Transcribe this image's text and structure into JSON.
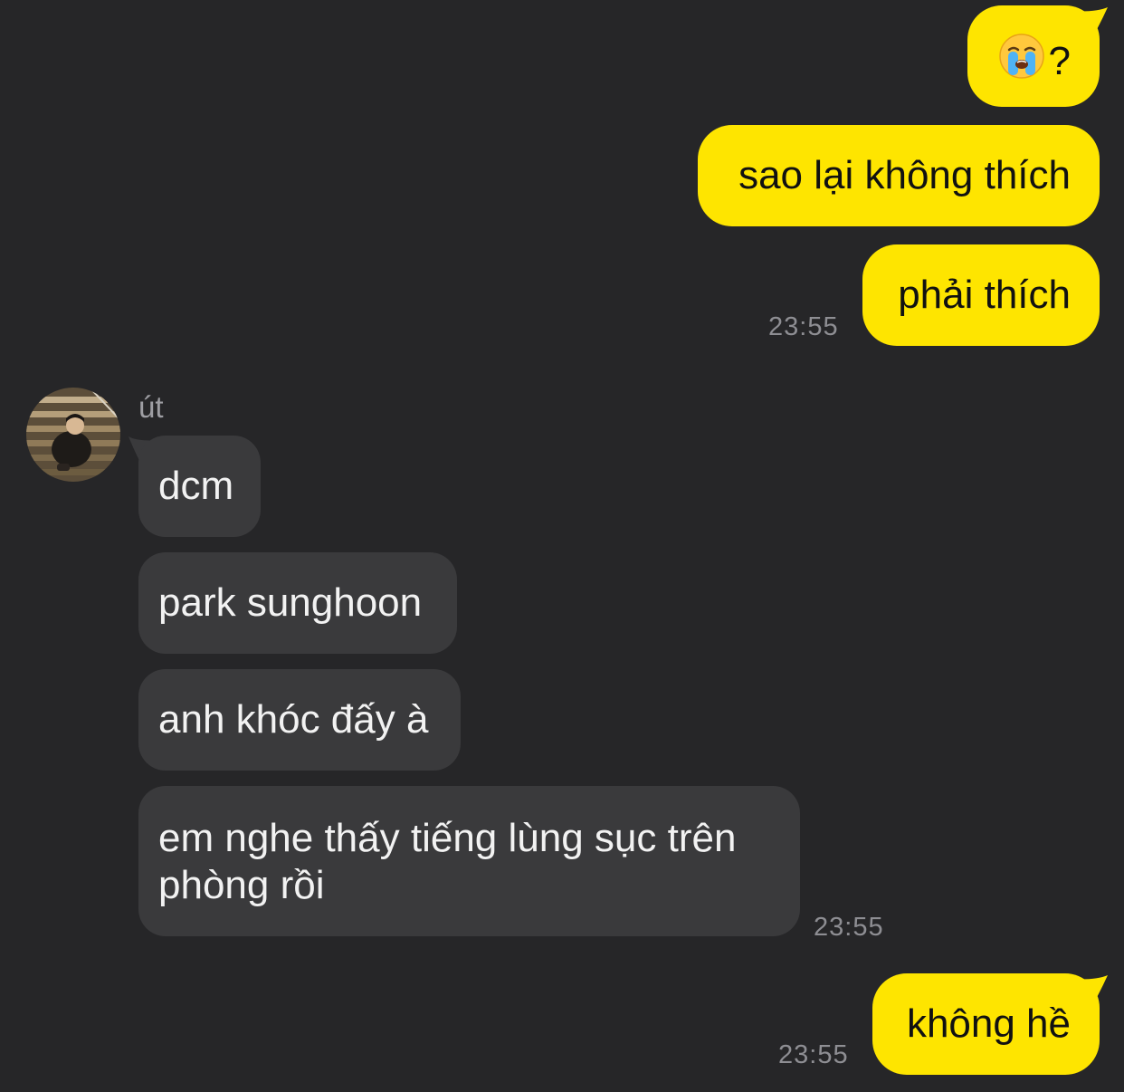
{
  "chat": {
    "contact_name": "út",
    "messages": [
      {
        "id": "m1",
        "direction": "out",
        "emoji": "crying-face",
        "text": "?"
      },
      {
        "id": "m2",
        "direction": "out",
        "text": "sao lại không thích"
      },
      {
        "id": "m3",
        "direction": "out",
        "text": "phải thích",
        "time": "23:55"
      },
      {
        "id": "m4",
        "direction": "in",
        "text": "dcm"
      },
      {
        "id": "m5",
        "direction": "in",
        "text": "park sunghoon"
      },
      {
        "id": "m6",
        "direction": "in",
        "text": "anh khóc đấy à"
      },
      {
        "id": "m7",
        "direction": "in",
        "line1": "em nghe thấy tiếng lùng sục trên",
        "line2": "phòng rồi",
        "time": "23:55"
      },
      {
        "id": "m8",
        "direction": "out",
        "text": "không hề",
        "time": "23:55"
      }
    ]
  },
  "colors": {
    "background": "#262628",
    "outgoing_bubble": "#FEE500",
    "incoming_bubble": "#3A3A3C",
    "timestamp": "#8E8E93"
  }
}
